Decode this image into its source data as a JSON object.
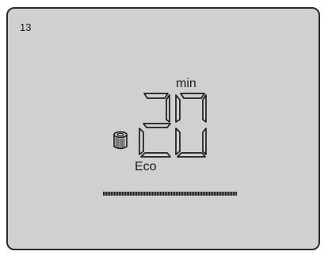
{
  "display": {
    "screen_number": "13",
    "time_value": "20",
    "time_unit": "min",
    "mode_label": "Eco",
    "progress_percent": 100
  },
  "icons": {
    "filter": "filter-cartridge-icon"
  },
  "colors": {
    "lcd_background": "#d0d0d0",
    "segment_ink": "#1c1c1c",
    "frame_border": "#2a2a2a"
  }
}
